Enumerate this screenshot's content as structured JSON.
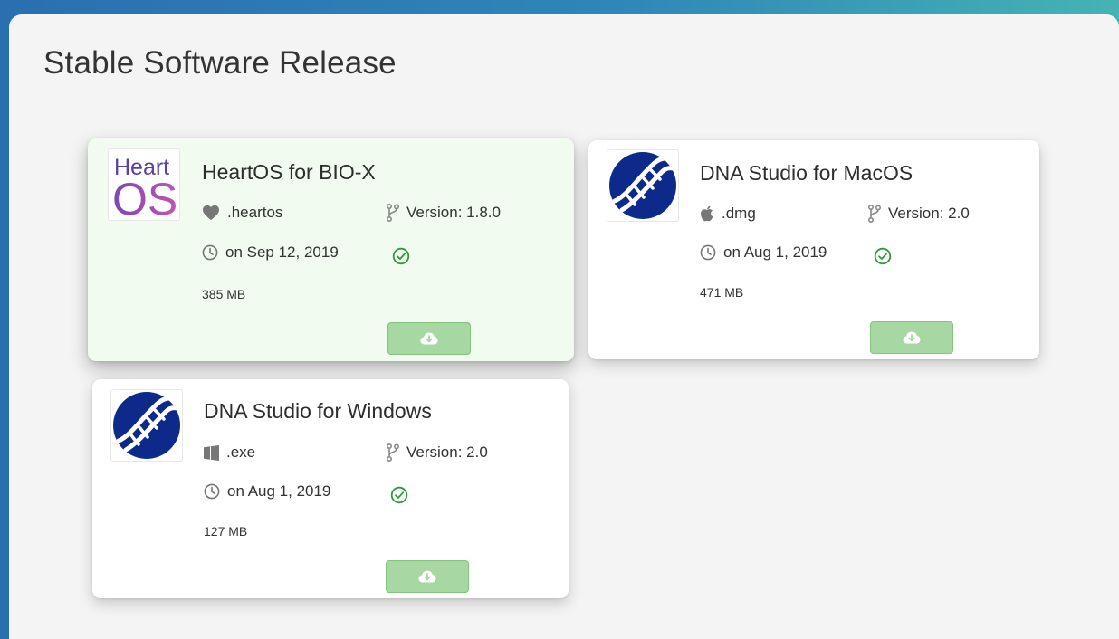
{
  "page": {
    "title": "Stable Software Release"
  },
  "colors": {
    "header_gradient_start": "#2a6fb0",
    "header_gradient_end": "#46b3b3",
    "card_active_bg": "#f1fbef",
    "download_button": "#a7d7a2",
    "check_green": "#2e9a3a",
    "dna_logo_blue": "#0d2a8a",
    "heartos_logo_purple": "#6a3bb0"
  },
  "releases": [
    {
      "name": "HeartOS for BIO-X",
      "logo_icon": "heartos-logo",
      "logo_text_line1": "Heart",
      "logo_text_line2": "OS",
      "file_type_icon": "heart-icon",
      "file_type": ".heartos",
      "version": "Version: 1.8.0",
      "date": "on Sep 12, 2019",
      "verified_icon": "check-circle-icon",
      "size": "385 MB",
      "download_icon": "cloud-download-icon"
    },
    {
      "name": "DNA Studio for MacOS",
      "logo_icon": "dna-studio-logo",
      "file_type_icon": "apple-icon",
      "file_type": ".dmg",
      "version": "Version: 2.0",
      "date": "on Aug 1, 2019",
      "verified_icon": "check-circle-icon",
      "size": "471 MB",
      "download_icon": "cloud-download-icon"
    },
    {
      "name": "DNA Studio for Windows",
      "logo_icon": "dna-studio-logo",
      "file_type_icon": "windows-icon",
      "file_type": ".exe",
      "version": "Version: 2.0",
      "date": "on Aug 1, 2019",
      "verified_icon": "check-circle-icon",
      "size": "127 MB",
      "download_icon": "cloud-download-icon"
    }
  ]
}
